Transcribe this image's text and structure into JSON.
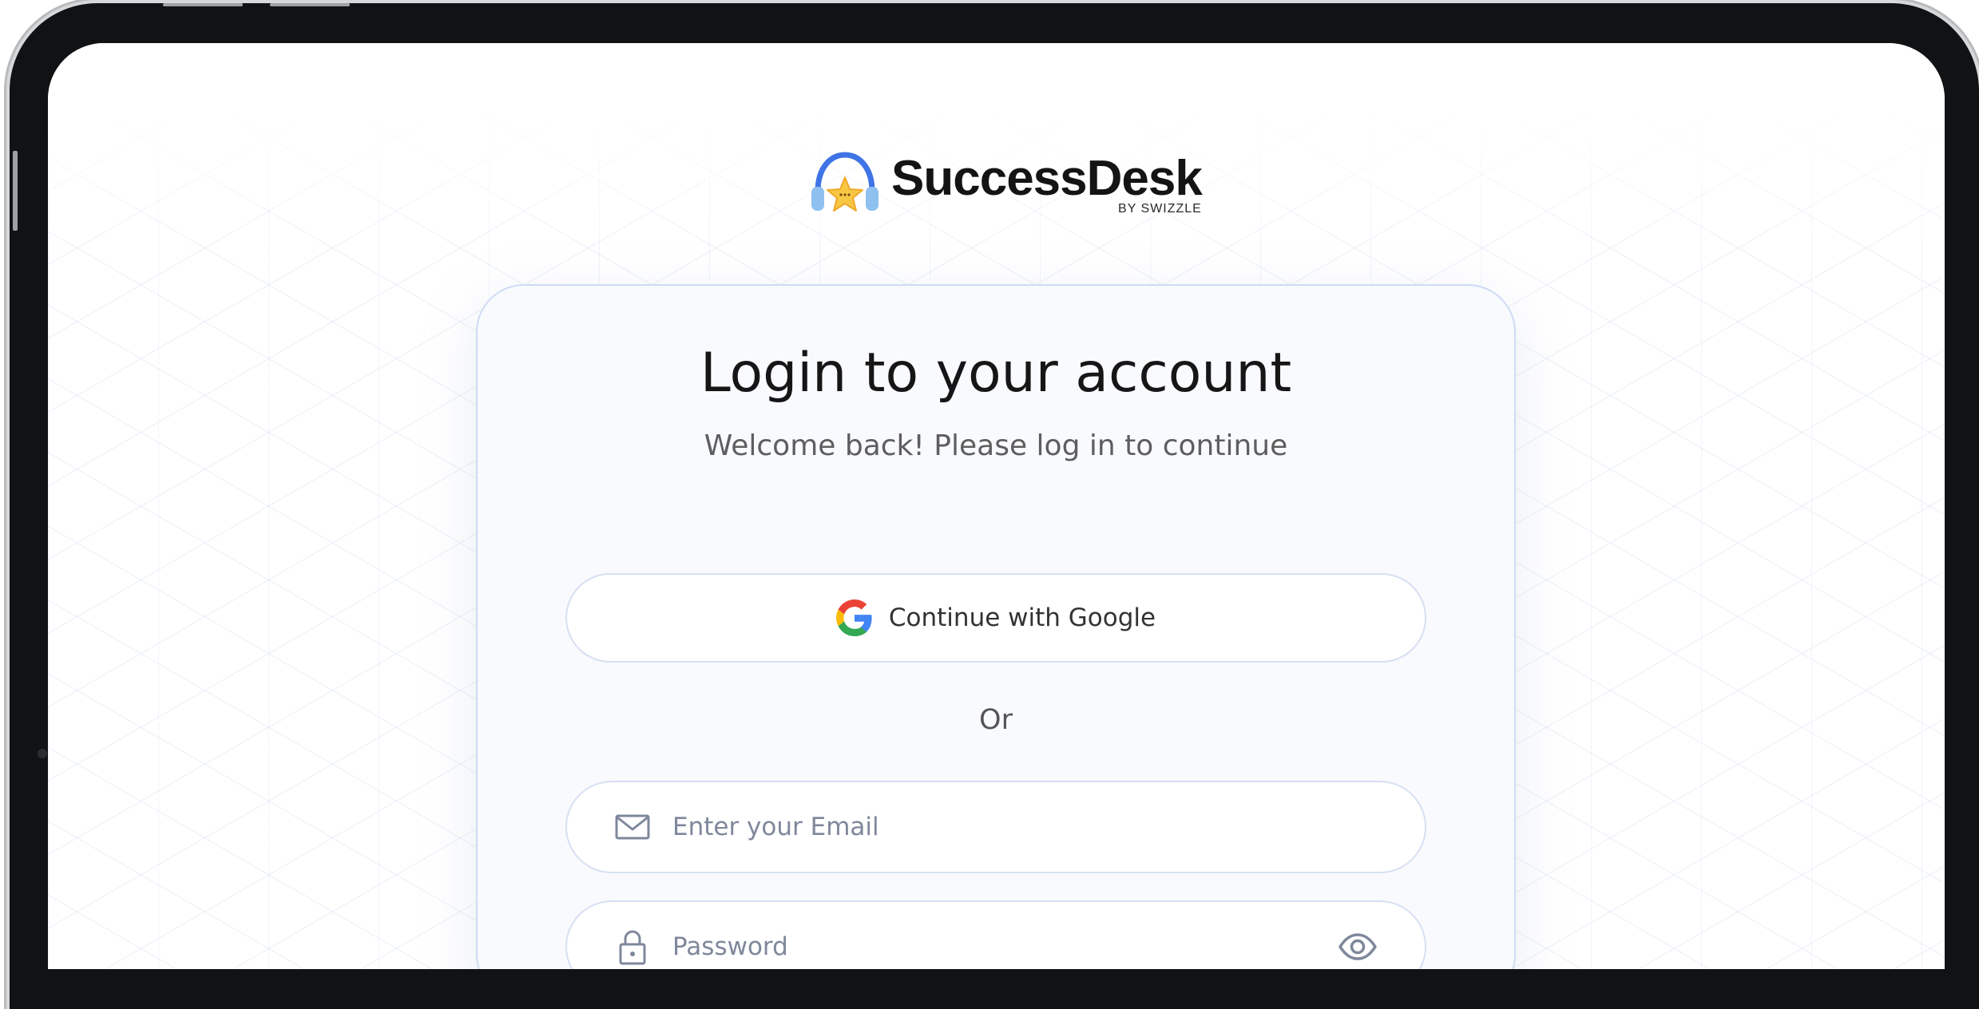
{
  "logo": {
    "name": "SuccessDesk",
    "byline": "BY SWIZZLE"
  },
  "login": {
    "title": "Login to your account",
    "subtitle": "Welcome back! Please log in to continue",
    "google_button_label": "Continue with Google",
    "divider_text": "Or",
    "email_placeholder": "Enter your Email",
    "email_value": "",
    "password_placeholder": "Password",
    "password_value": ""
  },
  "icons": {
    "logo": "headset-star-icon",
    "google": "google-g-icon",
    "email": "envelope-icon",
    "password": "lock-icon",
    "toggle_visibility": "eye-icon"
  },
  "colors": {
    "card_border": "#cfdcf3",
    "field_border": "#d6e0f2",
    "placeholder": "#7f879b",
    "logo_blue": "#3f74e6",
    "logo_yellow": "#f7c744"
  }
}
